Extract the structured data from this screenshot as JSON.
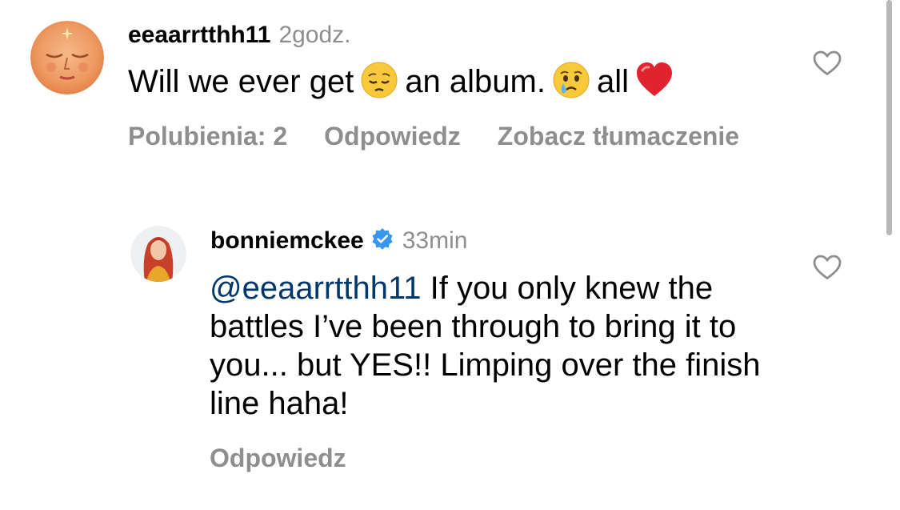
{
  "comment": {
    "username": "eeaarrtthh11",
    "time": "2godz.",
    "text_parts": [
      "Will we ever get",
      "an album.",
      "all"
    ],
    "emojis": [
      "pensive-face-emoji",
      "crying-face-emoji",
      "red-heart-emoji"
    ],
    "likes_label": "Polubienia: 2",
    "reply_label": "Odpowiedz",
    "translate_label": "Zobacz tłumaczenie",
    "like_icon": "heart-outline-icon"
  },
  "reply": {
    "username": "bonniemckee",
    "verified_icon": "verified-badge-icon",
    "time": "33min",
    "mention": "@eeaarrtthh11",
    "text": " If you only knew the battles I’ve been through to bring it to you... but YES!! Limping over the finish line haha!",
    "reply_label": "Odpowiedz",
    "like_icon": "heart-outline-icon"
  },
  "colors": {
    "secondary_text": "#8e8e8e",
    "mention": "#00376b",
    "verified": "#3797f0",
    "heart_emoji": "#e0242f"
  }
}
